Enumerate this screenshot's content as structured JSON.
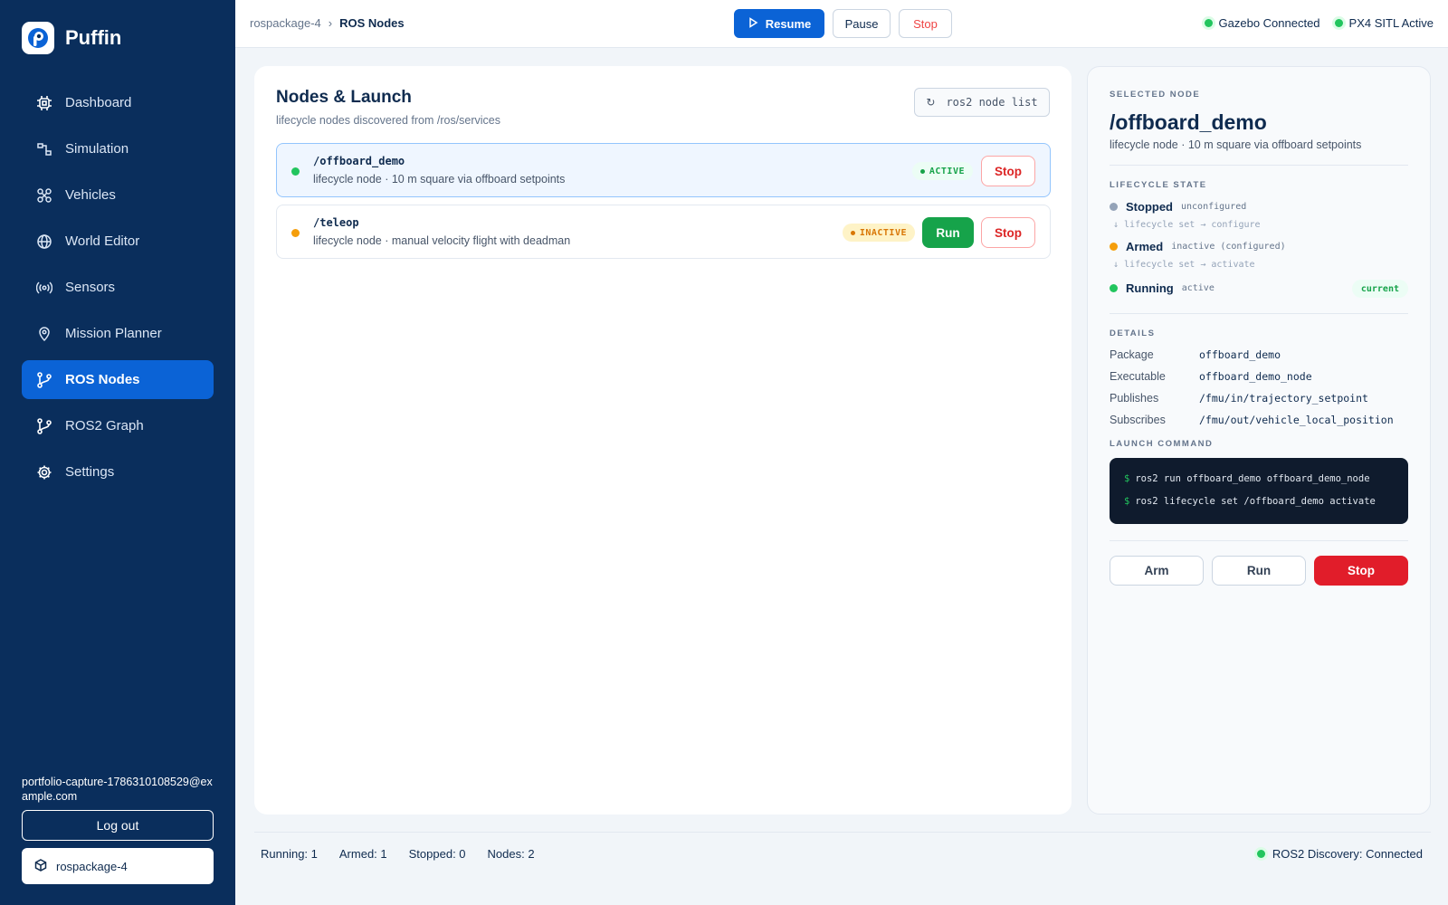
{
  "app": {
    "name": "Puffin"
  },
  "sidebar": {
    "items": [
      {
        "label": "Dashboard",
        "icon": "chip-icon"
      },
      {
        "label": "Simulation",
        "icon": "flow-icon"
      },
      {
        "label": "Vehicles",
        "icon": "drone-icon"
      },
      {
        "label": "World Editor",
        "icon": "globe-icon"
      },
      {
        "label": "Sensors",
        "icon": "broadcast-icon"
      },
      {
        "label": "Mission Planner",
        "icon": "pin-icon"
      },
      {
        "label": "ROS Nodes",
        "icon": "branch-icon",
        "active": true
      },
      {
        "label": "ROS2 Graph",
        "icon": "branch-icon"
      },
      {
        "label": "Settings",
        "icon": "gear-icon"
      }
    ],
    "user_email": "portfolio-capture-1786310108529@example.com",
    "logout_label": "Log out",
    "project": "rospackage-4"
  },
  "topbar": {
    "breadcrumb": {
      "project": "rospackage-4",
      "separator": "›",
      "page": "ROS Nodes"
    },
    "resume_label": "Resume",
    "pause_label": "Pause",
    "stop_label": "Stop",
    "status": [
      {
        "label": "Gazebo Connected"
      },
      {
        "label": "PX4 SITL Active"
      }
    ]
  },
  "main": {
    "title": "Nodes & Launch",
    "subtitle": "lifecycle nodes discovered from /ros/services",
    "refresh_command": "ros2 node list",
    "nodes": [
      {
        "name": "/offboard_demo",
        "desc": "lifecycle node · 10 m square via offboard setpoints",
        "status": "ACTIVE",
        "stop_label": "Stop"
      },
      {
        "name": "/teleop",
        "desc": "lifecycle node · manual velocity flight with deadman",
        "status": "INACTIVE",
        "run_label": "Run",
        "stop_label": "Stop"
      }
    ]
  },
  "detail": {
    "selected_label": "SELECTED NODE",
    "name": "/offboard_demo",
    "desc": "lifecycle node · 10 m square via offboard setpoints",
    "lifecycle_label": "LIFECYCLE STATE",
    "states": [
      {
        "name": "Stopped",
        "tag": "unconfigured",
        "color": "#94a3b8"
      },
      {
        "name": "Armed",
        "tag": "inactive (configured)",
        "color": "#f59e0b"
      },
      {
        "name": "Running",
        "tag": "active",
        "color": "#22c55e"
      }
    ],
    "transitions": [
      "↓ lifecycle set → configure",
      "↓ lifecycle set → activate"
    ],
    "current_label": "current",
    "details_label": "DETAILS",
    "fields": [
      {
        "k": "Package",
        "v": "offboard_demo"
      },
      {
        "k": "Executable",
        "v": "offboard_demo_node"
      },
      {
        "k": "Publishes",
        "v": "/fmu/in/trajectory_setpoint"
      },
      {
        "k": "Subscribes",
        "v": "/fmu/out/vehicle_local_position"
      }
    ],
    "launch_label": "LAUNCH COMMAND",
    "launch_lines": [
      "ros2 run offboard_demo offboard_demo_node",
      "ros2 lifecycle set /offboard_demo activate"
    ],
    "prompt": "$",
    "arm_label": "Arm",
    "run_label": "Run",
    "stop_label": "Stop"
  },
  "footer": {
    "running": "Running: 1",
    "armed": "Armed: 1",
    "stopped": "Stopped: 0",
    "nodes": "Nodes: 2",
    "discovery": "ROS2 Discovery: Connected"
  }
}
